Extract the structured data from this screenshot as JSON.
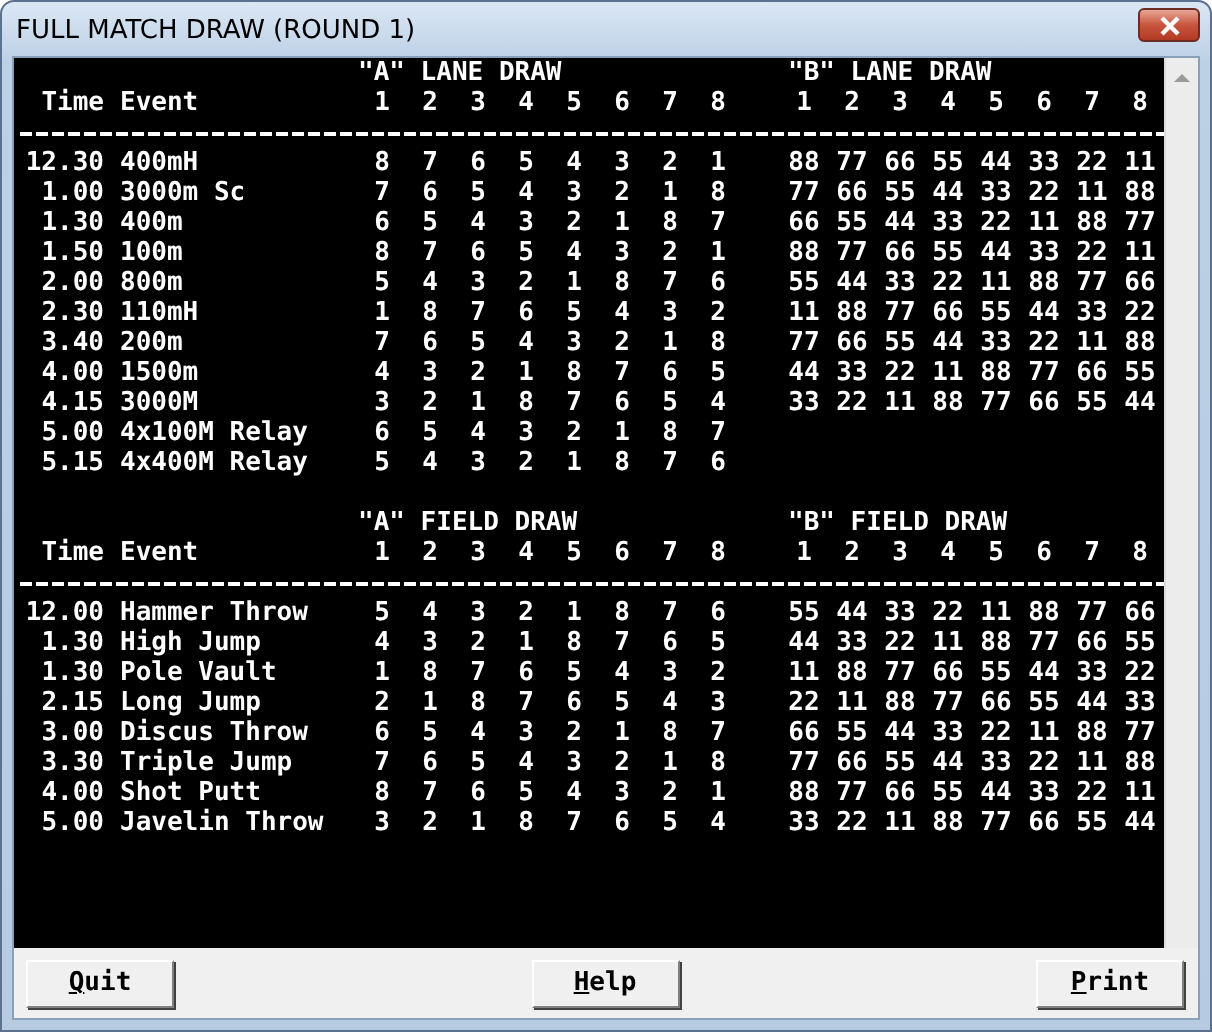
{
  "window": {
    "title": "FULL MATCH DRAW (ROUND 1)"
  },
  "sections": [
    {
      "groups": [
        {
          "title": "\"A\" LANE DRAW"
        },
        {
          "title": "\"B\" LANE DRAW"
        }
      ],
      "columns": {
        "time": "Time",
        "event": "Event",
        "a_lanes": [
          "1",
          "2",
          "3",
          "4",
          "5",
          "6",
          "7",
          "8"
        ],
        "b_lanes": [
          "1",
          "2",
          "3",
          "4",
          "5",
          "6",
          "7",
          "8"
        ]
      },
      "rows": [
        {
          "time": "12.30",
          "event": "400mH",
          "a": [
            "8",
            "7",
            "6",
            "5",
            "4",
            "3",
            "2",
            "1"
          ],
          "b": [
            "88",
            "77",
            "66",
            "55",
            "44",
            "33",
            "22",
            "11"
          ]
        },
        {
          "time": "1.00",
          "event": "3000m Sc",
          "a": [
            "7",
            "6",
            "5",
            "4",
            "3",
            "2",
            "1",
            "8"
          ],
          "b": [
            "77",
            "66",
            "55",
            "44",
            "33",
            "22",
            "11",
            "88"
          ]
        },
        {
          "time": "1.30",
          "event": "400m",
          "a": [
            "6",
            "5",
            "4",
            "3",
            "2",
            "1",
            "8",
            "7"
          ],
          "b": [
            "66",
            "55",
            "44",
            "33",
            "22",
            "11",
            "88",
            "77"
          ]
        },
        {
          "time": "1.50",
          "event": "100m",
          "a": [
            "8",
            "7",
            "6",
            "5",
            "4",
            "3",
            "2",
            "1"
          ],
          "b": [
            "88",
            "77",
            "66",
            "55",
            "44",
            "33",
            "22",
            "11"
          ]
        },
        {
          "time": "2.00",
          "event": "800m",
          "a": [
            "5",
            "4",
            "3",
            "2",
            "1",
            "8",
            "7",
            "6"
          ],
          "b": [
            "55",
            "44",
            "33",
            "22",
            "11",
            "88",
            "77",
            "66"
          ]
        },
        {
          "time": "2.30",
          "event": "110mH",
          "a": [
            "1",
            "8",
            "7",
            "6",
            "5",
            "4",
            "3",
            "2"
          ],
          "b": [
            "11",
            "88",
            "77",
            "66",
            "55",
            "44",
            "33",
            "22"
          ]
        },
        {
          "time": "3.40",
          "event": "200m",
          "a": [
            "7",
            "6",
            "5",
            "4",
            "3",
            "2",
            "1",
            "8"
          ],
          "b": [
            "77",
            "66",
            "55",
            "44",
            "33",
            "22",
            "11",
            "88"
          ]
        },
        {
          "time": "4.00",
          "event": "1500m",
          "a": [
            "4",
            "3",
            "2",
            "1",
            "8",
            "7",
            "6",
            "5"
          ],
          "b": [
            "44",
            "33",
            "22",
            "11",
            "88",
            "77",
            "66",
            "55"
          ]
        },
        {
          "time": "4.15",
          "event": "3000M",
          "a": [
            "3",
            "2",
            "1",
            "8",
            "7",
            "6",
            "5",
            "4"
          ],
          "b": [
            "33",
            "22",
            "11",
            "88",
            "77",
            "66",
            "55",
            "44"
          ]
        },
        {
          "time": "5.00",
          "event": "4x100M Relay",
          "a": [
            "6",
            "5",
            "4",
            "3",
            "2",
            "1",
            "8",
            "7"
          ]
        },
        {
          "time": "5.15",
          "event": "4x400M Relay",
          "a": [
            "5",
            "4",
            "3",
            "2",
            "1",
            "8",
            "7",
            "6"
          ]
        }
      ]
    },
    {
      "groups": [
        {
          "title": "\"A\" FIELD DRAW"
        },
        {
          "title": "\"B\" FIELD DRAW"
        }
      ],
      "columns": {
        "time": "Time",
        "event": "Event",
        "a_lanes": [
          "1",
          "2",
          "3",
          "4",
          "5",
          "6",
          "7",
          "8"
        ],
        "b_lanes": [
          "1",
          "2",
          "3",
          "4",
          "5",
          "6",
          "7",
          "8"
        ]
      },
      "rows": [
        {
          "time": "12.00",
          "event": "Hammer Throw",
          "a": [
            "5",
            "4",
            "3",
            "2",
            "1",
            "8",
            "7",
            "6"
          ],
          "b": [
            "55",
            "44",
            "33",
            "22",
            "11",
            "88",
            "77",
            "66"
          ]
        },
        {
          "time": "1.30",
          "event": "High Jump",
          "a": [
            "4",
            "3",
            "2",
            "1",
            "8",
            "7",
            "6",
            "5"
          ],
          "b": [
            "44",
            "33",
            "22",
            "11",
            "88",
            "77",
            "66",
            "55"
          ]
        },
        {
          "time": "1.30",
          "event": "Pole Vault",
          "a": [
            "1",
            "8",
            "7",
            "6",
            "5",
            "4",
            "3",
            "2"
          ],
          "b": [
            "11",
            "88",
            "77",
            "66",
            "55",
            "44",
            "33",
            "22"
          ]
        },
        {
          "time": "2.15",
          "event": "Long Jump",
          "a": [
            "2",
            "1",
            "8",
            "7",
            "6",
            "5",
            "4",
            "3"
          ],
          "b": [
            "22",
            "11",
            "88",
            "77",
            "66",
            "55",
            "44",
            "33"
          ]
        },
        {
          "time": "3.00",
          "event": "Discus Throw",
          "a": [
            "6",
            "5",
            "4",
            "3",
            "2",
            "1",
            "8",
            "7"
          ],
          "b": [
            "66",
            "55",
            "44",
            "33",
            "22",
            "11",
            "88",
            "77"
          ]
        },
        {
          "time": "3.30",
          "event": "Triple Jump",
          "a": [
            "7",
            "6",
            "5",
            "4",
            "3",
            "2",
            "1",
            "8"
          ],
          "b": [
            "77",
            "66",
            "55",
            "44",
            "33",
            "22",
            "11",
            "88"
          ]
        },
        {
          "time": "4.00",
          "event": "Shot Putt",
          "a": [
            "8",
            "7",
            "6",
            "5",
            "4",
            "3",
            "2",
            "1"
          ],
          "b": [
            "88",
            "77",
            "66",
            "55",
            "44",
            "33",
            "22",
            "11"
          ]
        },
        {
          "time": "5.00",
          "event": "Javelin Throw",
          "a": [
            "3",
            "2",
            "1",
            "8",
            "7",
            "6",
            "5",
            "4"
          ],
          "b": [
            "33",
            "22",
            "11",
            "88",
            "77",
            "66",
            "55",
            "44"
          ]
        }
      ]
    }
  ],
  "buttons": [
    {
      "label": "Quit"
    },
    {
      "label": "Help"
    },
    {
      "label": "Print"
    }
  ]
}
